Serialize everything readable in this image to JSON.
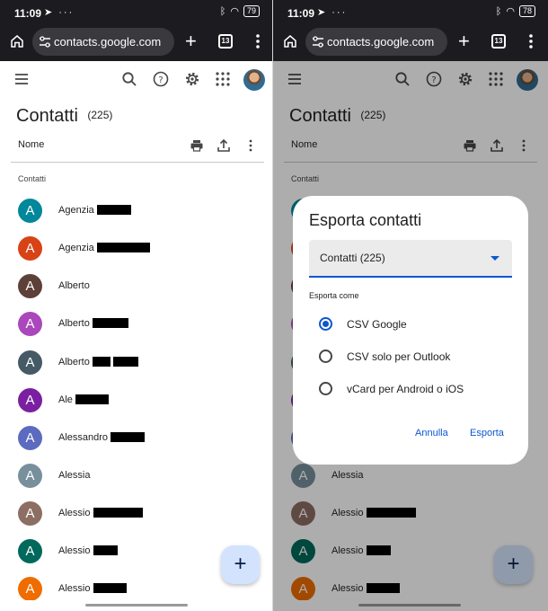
{
  "status": {
    "time": "11:09",
    "battery_left": "79",
    "battery_right": "78"
  },
  "browser": {
    "url": "contacts.google.com",
    "tab_count": "13"
  },
  "page": {
    "title": "Contatti",
    "count": "(225)",
    "sort_label": "Nome",
    "section_label": "Contatti"
  },
  "contacts": [
    {
      "initial": "A",
      "name": "Agenzia",
      "color": "#00889a"
    },
    {
      "initial": "A",
      "name": "Agenzia",
      "color": "#d84315"
    },
    {
      "initial": "A",
      "name": "Alberto",
      "color": "#5d4037"
    },
    {
      "initial": "A",
      "name": "Alberto",
      "color": "#ab47bc"
    },
    {
      "initial": "A",
      "name": "Alberto",
      "color": "#455a64"
    },
    {
      "initial": "A",
      "name": "Ale",
      "color": "#7b1fa2"
    },
    {
      "initial": "A",
      "name": "Alessandro",
      "color": "#5c6bc0"
    },
    {
      "initial": "A",
      "name": "Alessia",
      "color": "#78909c"
    },
    {
      "initial": "A",
      "name": "Alessio",
      "color": "#8d6e63"
    },
    {
      "initial": "A",
      "name": "Alessio",
      "color": "#00695c"
    },
    {
      "initial": "A",
      "name": "Alessio",
      "color": "#ef6c00"
    }
  ],
  "dialog": {
    "title": "Esporta contatti",
    "select_value": "Contatti (225)",
    "subtitle": "Esporta come",
    "options": [
      {
        "label": "CSV Google",
        "checked": true
      },
      {
        "label": "CSV solo per Outlook",
        "checked": false
      },
      {
        "label": "vCard per Android o iOS",
        "checked": false
      }
    ],
    "cancel_label": "Annulla",
    "export_label": "Esporta"
  },
  "colors": {
    "accent": "#0b57d0",
    "fab": "#d3e3fd",
    "scrim": "rgba(0,0,0,0.32)"
  }
}
